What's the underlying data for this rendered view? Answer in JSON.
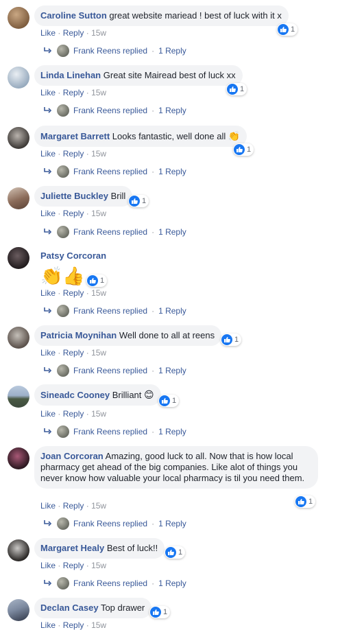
{
  "labels": {
    "like": "Like",
    "reply": "Reply",
    "dot": "·"
  },
  "comments": [
    {
      "author": "Caroline Sutton",
      "text": "great website mariead ! best of luck with it x",
      "time": "15w",
      "likes": "1",
      "replier": "Frank Reens replied",
      "replies": "1 Reply",
      "avatar_colors": [
        "#c9a783",
        "#7b5a3c"
      ]
    },
    {
      "author": "Linda Linehan",
      "text": "Great site Mairead best of luck xx",
      "time": "15w",
      "likes": "1",
      "replier": "Frank Reens replied",
      "replies": "1 Reply",
      "avatar_colors": [
        "#d9dfe6",
        "#8ea3b8"
      ]
    },
    {
      "author": "Margaret Barrett",
      "text": "Looks fantastic, well done all",
      "text_emoji": "👏",
      "time": "15w",
      "likes": "1",
      "replier": "Frank Reens replied",
      "replies": "1 Reply",
      "avatar_colors": [
        "#b9b3ad",
        "#3e3a37"
      ]
    },
    {
      "author": "Juliette Buckley",
      "text": "Brill",
      "time": "15w",
      "likes": "1",
      "replier": "Frank Reens replied",
      "replies": "1 Reply",
      "avatar_colors": [
        "#b48f7a",
        "#6a4b3e"
      ]
    },
    {
      "author": "Patsy Corcoran",
      "text": "",
      "big_emoji": "👏👍",
      "time": "15w",
      "likes": "1",
      "replier": "Frank Reens replied",
      "replies": "1 Reply",
      "avatar_colors": [
        "#5a4f52",
        "#221c1e"
      ]
    },
    {
      "author": "Patricia Moynihan",
      "text": "Well done to all at reens",
      "time": "15w",
      "likes": "1",
      "replier": "Frank Reens replied",
      "replies": "1 Reply",
      "avatar_colors": [
        "#a6a29c",
        "#5b514b"
      ]
    },
    {
      "author": "Sineadc Cooney",
      "text": "Brilliant",
      "text_emoji": "😊",
      "time": "15w",
      "likes": "1",
      "replier": "Frank Reens replied",
      "replies": "1 Reply",
      "avatar_colors": [
        "#9db0c9",
        "#3d4a3d"
      ]
    },
    {
      "author": "Joan Corcoran",
      "text": "Amazing, good luck to all. Now that is how local pharmacy get ahead of the big companies. Like alot of things you never know how valuable your local pharmacy is til you need them.",
      "time": "15w",
      "likes": "1",
      "replier": "Frank Reens replied",
      "replies": "1 Reply",
      "avatar_colors": [
        "#8c3f5a",
        "#2c1820"
      ]
    },
    {
      "author": "Margaret Healy",
      "text": "Best of luck!!",
      "time": "15w",
      "likes": "1",
      "replier": "Frank Reens replied",
      "replies": "1 Reply",
      "avatar_colors": [
        "#a9a7a5",
        "#2b2826"
      ]
    },
    {
      "author": "Declan Casey",
      "text": "Top drawer",
      "time": "15w",
      "likes": "1",
      "replier": "",
      "replies": "",
      "avatar_colors": [
        "#7d8aa0",
        "#2e3545"
      ]
    }
  ],
  "colors": {
    "author": "#385898",
    "meta": "#90949c",
    "bubble": "#f2f3f5",
    "like_blue": "#1877f2"
  },
  "icons": {
    "like": "thumbs-up-icon",
    "reply_arrow": "reply-arrow-icon"
  }
}
